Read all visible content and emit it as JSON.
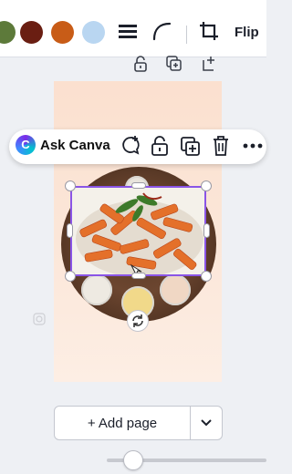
{
  "toolbar": {
    "colors": [
      "#5d7a3a",
      "#6a1e12",
      "#c85c17",
      "#b9d6f1"
    ],
    "flip_label": "Flip",
    "icons": [
      "line-weight-icon",
      "corner-rounding-icon",
      "crop-icon"
    ]
  },
  "page_actions": [
    "lock-icon",
    "duplicate-page-icon",
    "add-page-icon"
  ],
  "floating_bar": {
    "badge": "C",
    "ask_label": "Ask Canva",
    "icons": [
      "comment-add-icon",
      "lock-icon",
      "duplicate-icon",
      "delete-icon",
      "more-icon"
    ]
  },
  "canvas": {
    "selection_color": "#8a55e6",
    "page_bg": "#fbe0cf"
  },
  "add_page": {
    "label": "+ Add page"
  },
  "colors": {
    "accent": "#8a55e6"
  }
}
